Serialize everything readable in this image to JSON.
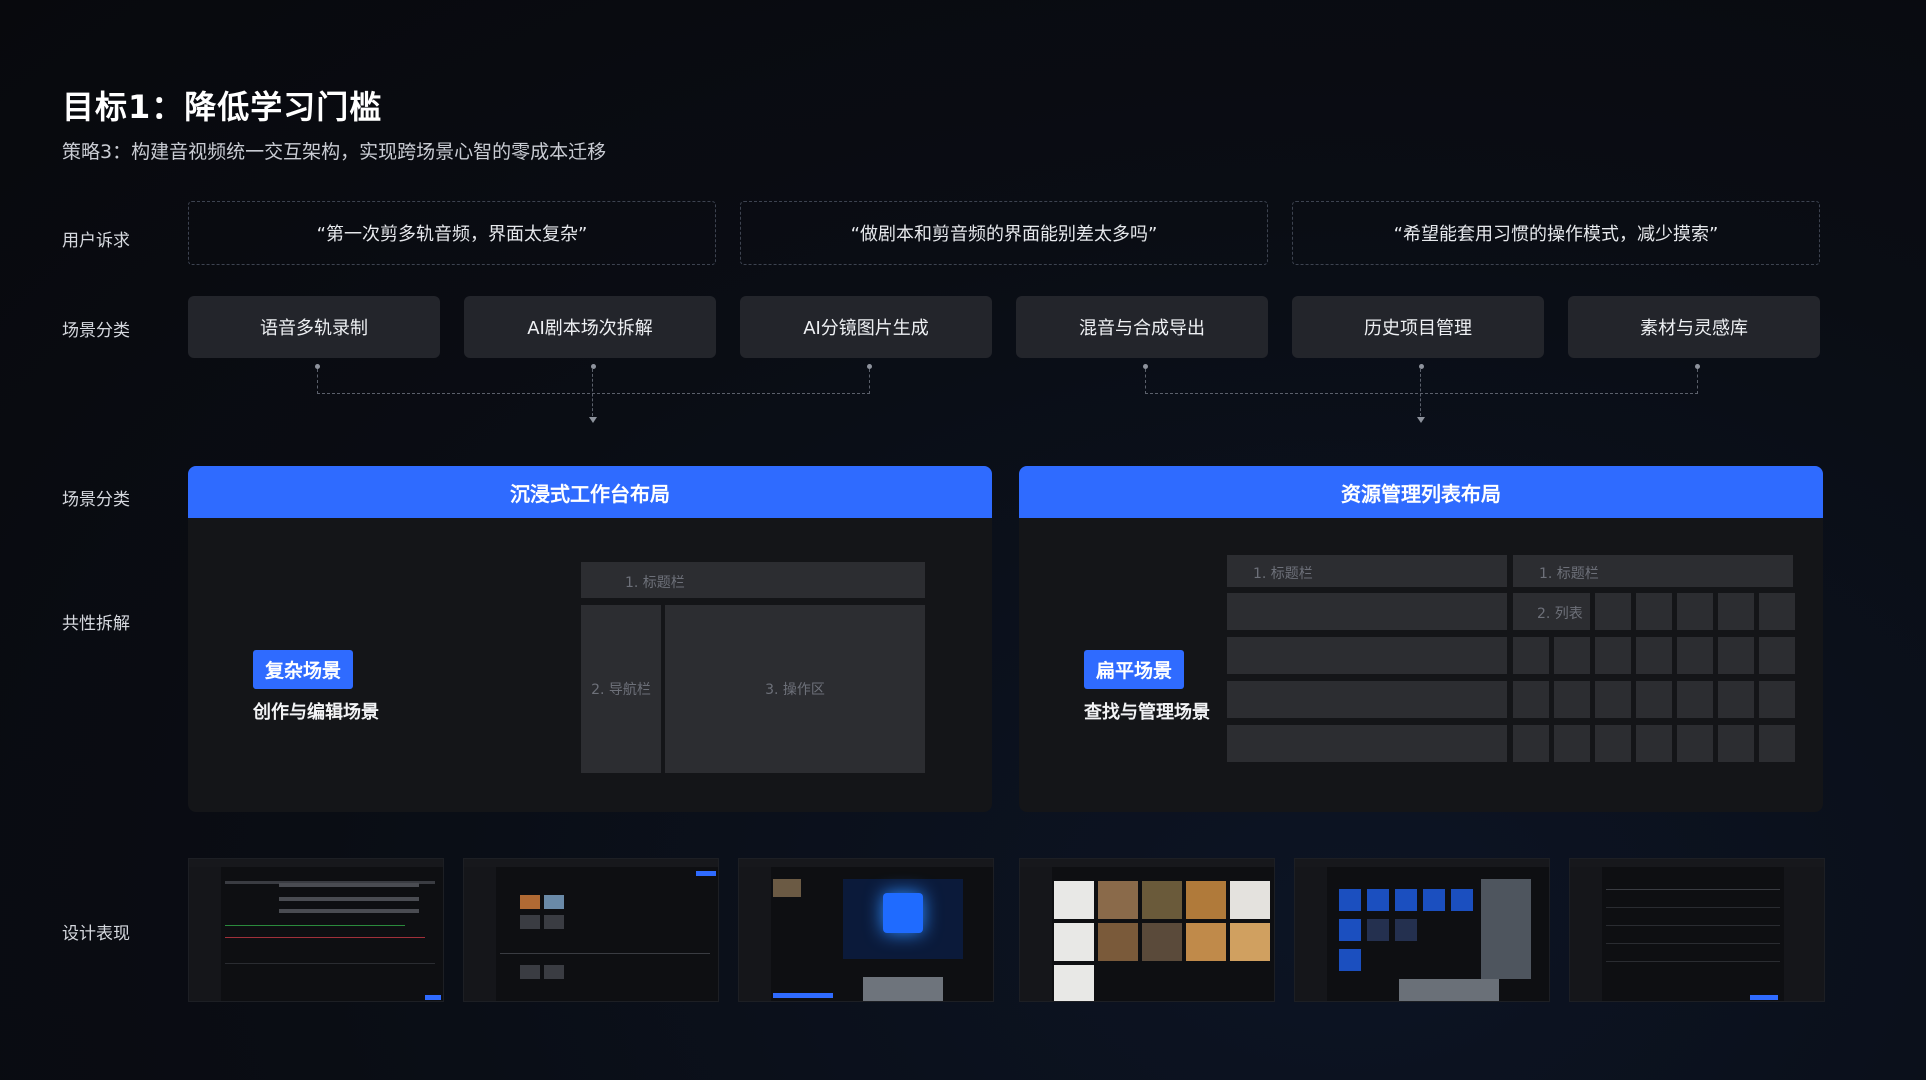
{
  "header": {
    "title": "目标1：降低学习门槛",
    "subtitle": "策略3：构建音视频统一交互架构，实现跨场景心智的零成本迁移"
  },
  "row_labels": {
    "user_needs": "用户诉求",
    "scene_category": "场景分类",
    "scene_category_2": "场景分类",
    "commonality": "共性拆解",
    "design": "设计表现"
  },
  "quotes": [
    "“第一次剪多轨音频，界面太复杂”",
    "“做剧本和剪音频的界面能别差太多吗”",
    "“希望能套用习惯的操作模式，减少摸索”"
  ],
  "scenes": [
    "语音多轨录制",
    "AI剧本场次拆解",
    "AI分镜图片生成",
    "混音与合成导出",
    "历史项目管理",
    "素材与灵感库"
  ],
  "layouts": {
    "immersive": {
      "title": "沉浸式工作台布局",
      "tag": "复杂场景",
      "desc": "创作与编辑场景",
      "wire_title": "1. 标题栏",
      "wire_nav": "2. 导航栏",
      "wire_work": "3. 操作区"
    },
    "resource": {
      "title": "资源管理列表布局",
      "tag": "扁平场景",
      "desc": "查找与管理场景",
      "wire_title_a": "1. 标题栏",
      "wire_title_b": "1. 标题栏",
      "wire_list": "2. 列表"
    }
  },
  "colors": {
    "accent": "#2f6bff",
    "card": "#23252b",
    "panel": "#141518"
  }
}
